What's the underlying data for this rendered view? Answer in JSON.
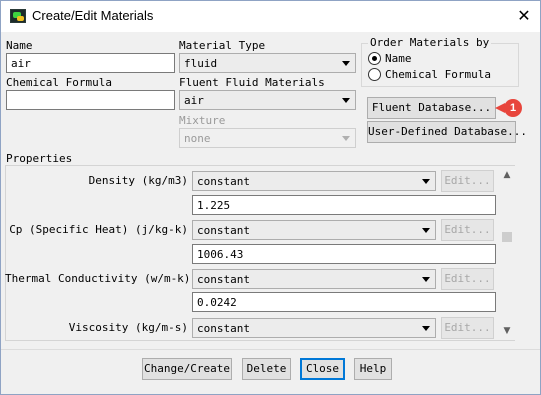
{
  "window": {
    "title": "Create/Edit Materials",
    "close_glyph": "✕"
  },
  "name": {
    "label": "Name",
    "value": "air"
  },
  "material_type": {
    "label": "Material Type",
    "value": "fluid"
  },
  "order": {
    "title": "Order Materials by",
    "options": [
      {
        "label": "Name",
        "selected": true
      },
      {
        "label": "Chemical Formula",
        "selected": false
      }
    ]
  },
  "chemical_formula": {
    "label": "Chemical Formula",
    "value": ""
  },
  "fluent_fluid_materials": {
    "label": "Fluent Fluid Materials",
    "value": "air"
  },
  "mixture": {
    "label": "Mixture",
    "value": "none",
    "enabled": false
  },
  "side_buttons": {
    "fluent_database": "Fluent Database...",
    "user_defined_database": "User-Defined Database..."
  },
  "callout": {
    "number": "1",
    "color": "#e8453c"
  },
  "properties": {
    "title": "Properties",
    "edit_label": "Edit...",
    "items": [
      {
        "label": "Density (kg/m3)",
        "method": "constant",
        "value": "1.225"
      },
      {
        "label": "Cp (Specific Heat) (j/kg-k)",
        "method": "constant",
        "value": "1006.43"
      },
      {
        "label": "Thermal Conductivity (w/m-k)",
        "method": "constant",
        "value": "0.0242"
      },
      {
        "label": "Viscosity (kg/m-s)",
        "method": "constant"
      }
    ]
  },
  "footer": {
    "change_create": "Change/Create",
    "delete": "Delete",
    "close": "Close",
    "help": "Help"
  },
  "icons": {
    "scroll_up": "▲",
    "scroll_down": "▼"
  },
  "colors": {
    "focus_border": "#0078d7",
    "window_bg": "#f0f0f0"
  }
}
